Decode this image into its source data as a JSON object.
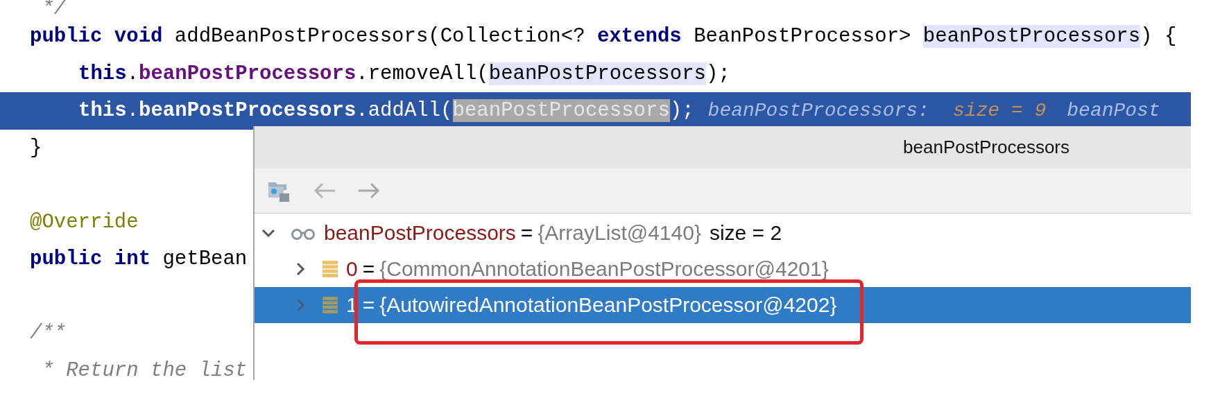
{
  "code_lines": [
    {
      "current": false,
      "tokens": [
        {
          "text": " */",
          "kind": "comment"
        }
      ]
    },
    {
      "current": false,
      "tokens": [
        {
          "text": "public void",
          "kind": "keyword"
        },
        {
          "text": " addBeanPostProcessors(Collection<? ",
          "kind": "plain"
        },
        {
          "text": "extends",
          "kind": "keyword"
        },
        {
          "text": " BeanPostProcessor> ",
          "kind": "plain"
        },
        {
          "text": "beanPostProcessors",
          "kind": "usage"
        },
        {
          "text": ") {",
          "kind": "plain"
        }
      ],
      "children": [
        {
          "current": false,
          "tokens": [
            {
              "text": "this",
              "kind": "keyword"
            },
            {
              "text": ".",
              "kind": "plain"
            },
            {
              "text": "beanPostProcessors",
              "kind": "field"
            },
            {
              "text": ".removeAll(",
              "kind": "plain"
            },
            {
              "text": "beanPostProcessors",
              "kind": "usage"
            },
            {
              "text": ");",
              "kind": "plain"
            }
          ]
        },
        {
          "current": true,
          "tokens": [
            {
              "text": "this",
              "kind": "keyword"
            },
            {
              "text": ".",
              "kind": "plain"
            },
            {
              "text": "beanPostProcessors",
              "kind": "field"
            },
            {
              "text": ".addAll(",
              "kind": "plain"
            },
            {
              "text": "beanPostProcessors",
              "kind": "usage"
            },
            {
              "text": ");",
              "kind": "plain"
            },
            {
              "text": "beanPostProcessors:",
              "kind": "hint"
            },
            {
              "text": "size = 9",
              "kind": "hint_value"
            },
            {
              "text": "beanPost",
              "kind": "hint"
            }
          ]
        }
      ]
    },
    {
      "current": false,
      "tokens": [
        {
          "text": "}",
          "kind": "plain"
        }
      ]
    },
    {
      "current": false
    },
    {
      "current": false,
      "tokens": [
        {
          "text": "@Override",
          "kind": "annotation"
        }
      ]
    },
    {
      "current": false,
      "tokens": [
        {
          "text": "public int",
          "kind": "keyword"
        },
        {
          "text": " getBean",
          "kind": "plain"
        }
      ]
    },
    {
      "current": false
    },
    {
      "current": false,
      "tokens": [
        {
          "text": "/**",
          "kind": "comment"
        }
      ]
    },
    {
      "current": false,
      "tokens": [
        {
          "text": " * Return the list",
          "kind": "comment"
        }
      ]
    }
  ],
  "popup": {
    "title": "beanPostProcessors",
    "tree": [
      {
        "kind": "watch",
        "name": "beanPostProcessors",
        "operator": "=",
        "value": "{ArrayList@4140}",
        "extra": "size = 2",
        "expanded": true,
        "selected": false,
        "outlined": false,
        "children": [
          {
            "kind": "element",
            "name": "0",
            "operator": "=",
            "value": "{CommonAnnotationBeanPostProcessor@4201}",
            "expanded": false,
            "selected": false,
            "outlined": false
          },
          {
            "kind": "element",
            "name": "1",
            "operator": "=",
            "value": "{AutowiredAnnotationBeanPostProcessor@4202}",
            "expanded": false,
            "selected": true,
            "outlined": true
          }
        ]
      }
    ]
  }
}
